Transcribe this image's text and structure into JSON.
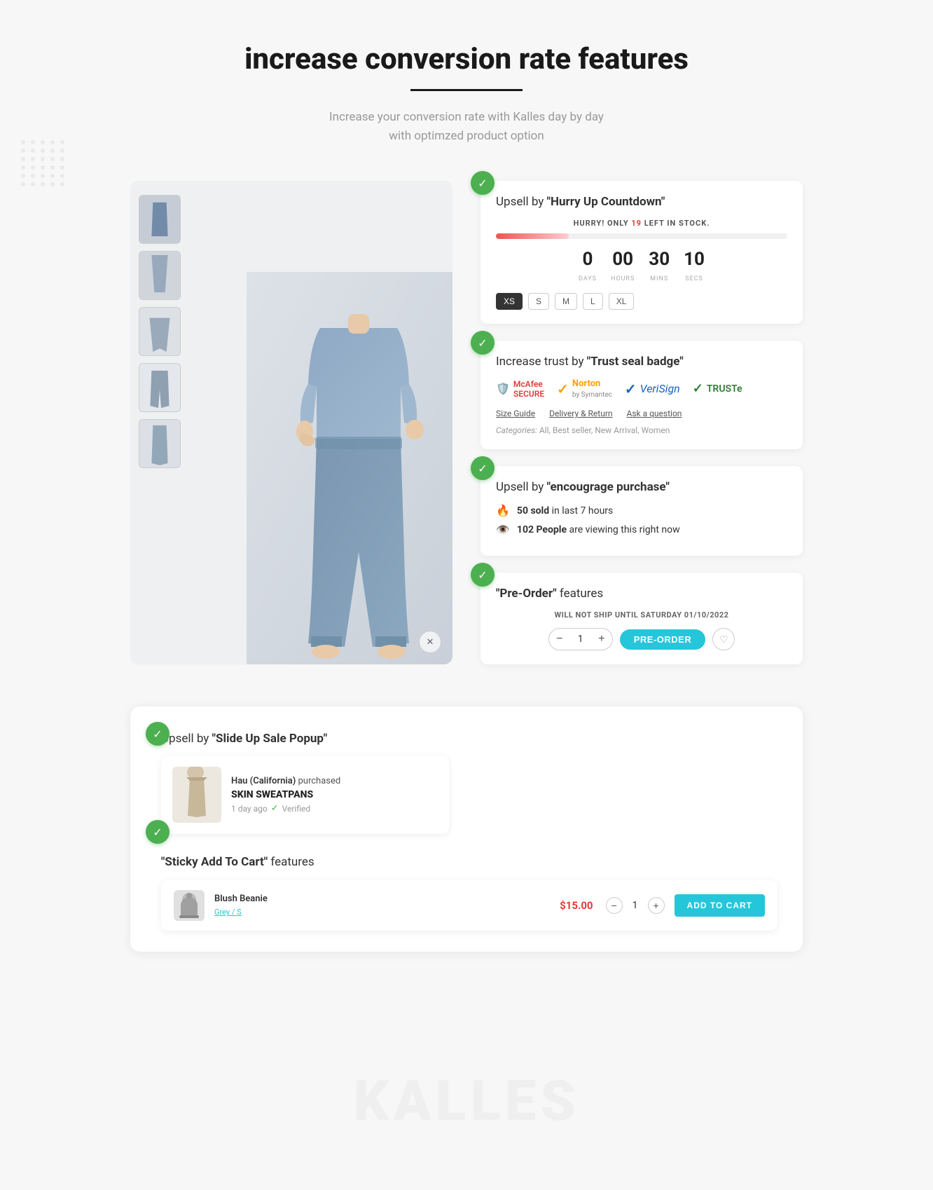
{
  "page": {
    "title": "increase conversion rate features",
    "subtitle_line1": "Increase your conversion rate with Kalles  day by day",
    "subtitle_line2": "with optimzed product option",
    "underline_color": "#1a1a1a"
  },
  "feature_hurry": {
    "title_prefix": "Upsell by ",
    "title_bold": "\"Hurry Up Countdown\"",
    "hurry_text": "HURRY! ONLY ",
    "hurry_count": "19",
    "hurry_suffix": " LEFT IN STOCK.",
    "countdown": {
      "days": "0",
      "days_label": "DAYS",
      "hours": "00",
      "hours_label": "HOURS",
      "mins": "30",
      "mins_label": "MINS",
      "secs": "10",
      "secs_label": "SECS"
    },
    "sizes": [
      "XS",
      "S",
      "M",
      "L",
      "XL"
    ]
  },
  "feature_trust": {
    "title_prefix": "Increase trust by ",
    "title_bold": "\"Trust seal badge\"",
    "badges": [
      {
        "name": "McAfee SECURE",
        "icon": "🛡️",
        "class": "mcafee"
      },
      {
        "name": "Norton",
        "icon": "✓",
        "class": "norton"
      },
      {
        "name": "VeriSign",
        "icon": "✓",
        "class": "verisign"
      },
      {
        "name": "TRUSTe",
        "icon": "✓",
        "class": "truste"
      }
    ],
    "links": [
      "Size Guide",
      "Delivery & Return",
      "Ask a question"
    ],
    "categories_label": "Categories:",
    "categories_value": "All, Best seller, New Arrival, Women"
  },
  "feature_encourage": {
    "title_prefix": "Upsell by ",
    "title_bold": "\"encougrage purchase\"",
    "items": [
      {
        "icon": "🔥",
        "text_prefix": "",
        "text_bold": "50 sold",
        "text_suffix": " in last 7 hours"
      },
      {
        "icon": "👁️",
        "text_prefix": "",
        "text_bold": "102 People",
        "text_suffix": " are viewing this right now"
      }
    ]
  },
  "feature_preorder": {
    "title_prefix": "",
    "title_bold": "\"Pre-Order\"",
    "title_suffix": " features",
    "ship_note": "WILL NOT SHIP UNTIL SATURDAY 01/10/2022",
    "qty": "1",
    "btn_label": "PRE-ORDER"
  },
  "feature_popup": {
    "title_prefix": "Upsell by ",
    "title_bold": "\"Slide Up Sale Popup\"",
    "buyer_name": "Hau (California)",
    "buyer_action": "purchased",
    "product_name": "SKIN SWEATPANS",
    "time_ago": "1 day ago",
    "verified_label": "Verified"
  },
  "feature_sticky": {
    "title_prefix": "",
    "title_bold": "\"Sticky Add To Cart\"",
    "title_suffix": " features",
    "product_name": "Blush Beanie",
    "variant": "Grey / S",
    "price": "$15.00",
    "qty": "1",
    "btn_label": "ADD TO CART"
  }
}
